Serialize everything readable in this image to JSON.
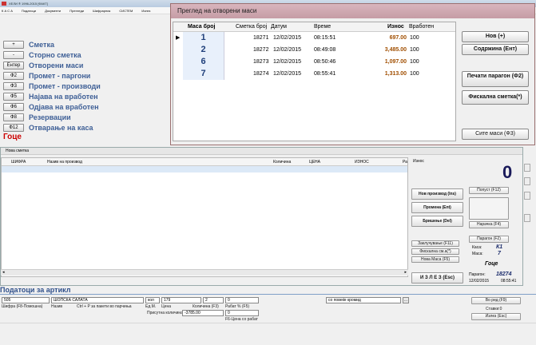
{
  "window": {
    "title": "ХЕЛИ ® 1996-2015 [ФАКТ]",
    "menu": [
      "К А С А",
      "Податоци",
      "Документи",
      "Прегледи",
      "Шифрарник",
      "СИСТЕМ",
      "Излез"
    ]
  },
  "commands": [
    {
      "key": "+",
      "label": "Сметка"
    },
    {
      "key": "-",
      "label": "Сторно сметка"
    },
    {
      "key": "Ентер",
      "label": "Отворени маси"
    },
    {
      "key": "Ф2",
      "label": "Промет - паргони"
    },
    {
      "key": "Ф3",
      "label": "Промет - производи"
    },
    {
      "key": "Ф5",
      "label": "Најава на вработен"
    },
    {
      "key": "Ф6",
      "label": "Одјава на вработен"
    },
    {
      "key": "Ф8",
      "label": "Резервации"
    },
    {
      "key": "Ф12",
      "label": "Отварање на каса"
    }
  ],
  "user_name": "Гоце",
  "tables_dialog": {
    "title": "Преглед на отворени маси",
    "columns": [
      "Маса број",
      "Сметка број",
      "Датум",
      "Време",
      "Износ",
      "Вработен"
    ],
    "rows": [
      {
        "table": "1",
        "bill": "18271",
        "date": "12/02/2015",
        "time": "08:15:51",
        "amount": "697.00",
        "employee": "100"
      },
      {
        "table": "2",
        "bill": "18272",
        "date": "12/02/2015",
        "time": "08:49:08",
        "amount": "3,485.00",
        "employee": "100"
      },
      {
        "table": "6",
        "bill": "18273",
        "date": "12/02/2015",
        "time": "08:50:46",
        "amount": "1,097.00",
        "employee": "100"
      },
      {
        "table": "7",
        "bill": "18274",
        "date": "12/02/2015",
        "time": "08:55:41",
        "amount": "1,313.00",
        "employee": "100"
      }
    ],
    "buttons": {
      "new": "Нов (+)",
      "content": "Содржина (Ент)",
      "print_receipt": "Печати парагон (Ф2)",
      "fiscal_bill": "Фискална сметка(*)",
      "all_tables": "Сите маси (Ф3)"
    }
  },
  "bill_window": {
    "title": "Нова сметка",
    "columns": [
      "ШИФРА",
      "Назив на производ",
      "Количина",
      "ЦЕНА",
      "ИЗНОС",
      "Ра"
    ],
    "amount_label": "Износ",
    "amount_value": "0",
    "buttons": {
      "new_product": "Нов производ (Ins)",
      "edit": "Промена (Ent)",
      "delete": "Бришење (Del)",
      "discount": "Попуст (F12)",
      "order": "Нарачка (F4)",
      "receipt": "Парагон (F2)",
      "close": "Заклучување (F11)",
      "fiscal": "Фискална см.а(*)",
      "new_table": "Нова Маса (F5)",
      "exit": "И З Л Е З (Esc)"
    },
    "info": {
      "kasa_label": "Каса:",
      "kasa_value": "К1",
      "masa_label": "Маса:",
      "masa_value": "7",
      "user": "Гоце",
      "receipt_label": "Парагон:",
      "receipt_value": "18274",
      "date": "12/02/2015",
      "time": "08:55:41"
    }
  },
  "article": {
    "heading": "Податоци за артикл",
    "code": "505",
    "name": "ШОПСКА САЛАТА",
    "unit": "кол",
    "price": "179",
    "quantity": "2",
    "discount": "0",
    "present_qty": "-3785.00",
    "present_extra": "0",
    "note": "со повеќе кромид",
    "labels": {
      "code": "Шифра (F8-Помошна)",
      "name": "Назив",
      "ctrl": "Ctrl + P за пакети во парчиња",
      "unit": "Ед.М.",
      "price": "Цена",
      "qty": "Количина (F3)",
      "discount": "Рабат % (F5)",
      "present": "Присутна количина",
      "price_disc": "F6-Цена со рабат"
    },
    "right_buttons": {
      "in_order": "Во ред (F9)",
      "items": "Ставки:0",
      "exit": "Излез (Esc)"
    }
  },
  "colors": {
    "command_label": "#3e5f96",
    "dialog_title": "#c59ca5",
    "amount": "#a04e00",
    "user": "#c00000"
  }
}
